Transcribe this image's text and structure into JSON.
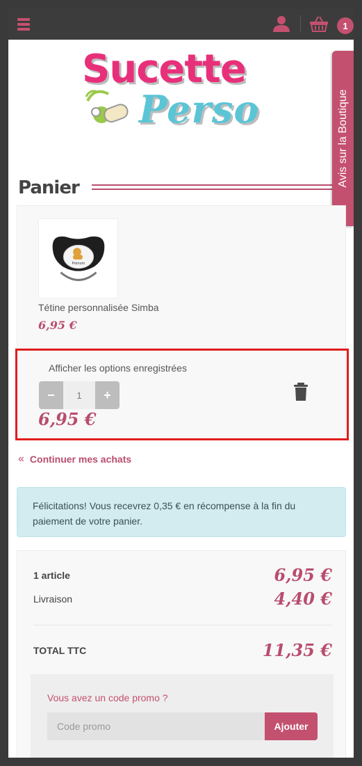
{
  "header": {
    "cart_count": "1"
  },
  "logo": {
    "line1": "Sucette",
    "line2": "Perso"
  },
  "page": {
    "title": "Panier"
  },
  "side_tab": {
    "label": "Avis sur la Boutique"
  },
  "cart": {
    "item": {
      "name": "Tétine personnalisée Simba",
      "unit_price": "6,95 €",
      "options_link": "Afficher les options enregistrées",
      "quantity": "1",
      "line_total": "6,95 €",
      "minus": "−",
      "plus": "+"
    }
  },
  "continue_shopping": {
    "chevron": "«",
    "label": "Continuer mes achats"
  },
  "notice": {
    "text": "Félicitations! Vous recevrez 0,35 € en récompense à la fin du paiement de votre panier."
  },
  "summary": {
    "articles_label": "1 article",
    "articles_value": "6,95 €",
    "shipping_label": "Livraison",
    "shipping_value": "4,40 €",
    "total_label": "TOTAL TTC",
    "total_value": "11,35 €"
  },
  "promo": {
    "question": "Vous avez un code promo ?",
    "placeholder": "Code promo",
    "button": "Ajouter"
  },
  "colors": {
    "accent": "#c4506f",
    "highlight_border": "#e11d1d",
    "notice_bg": "#d2ecf0"
  }
}
